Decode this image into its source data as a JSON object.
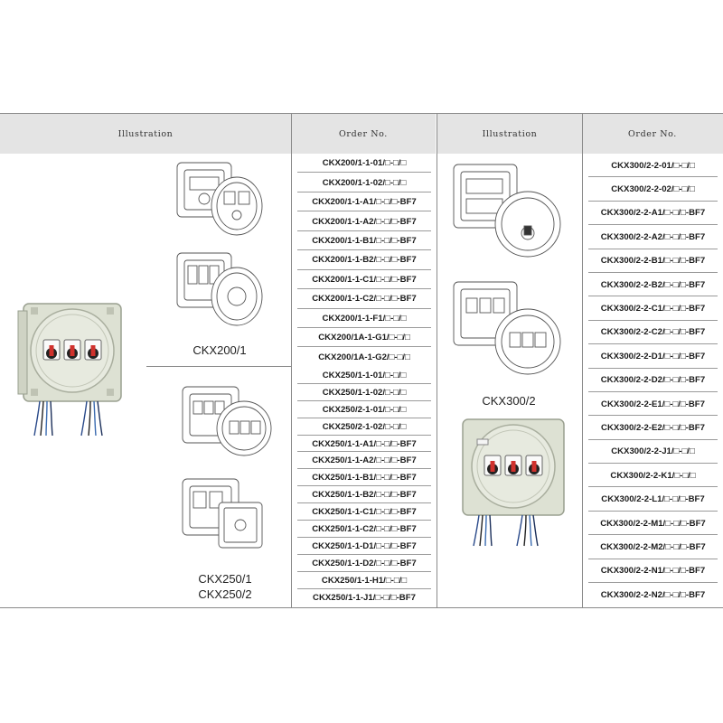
{
  "table": {
    "left_group": {
      "illustration_header": "Illustration",
      "order_header": "Order No.",
      "ckx200_label": "CKX200/1",
      "ckx250_label_line1": "CKX250/1",
      "ckx250_label_line2": "CKX250/2",
      "ckx200_orders": [
        "CKX200/1-1-01/□-□/□",
        "CKX200/1-1-02/□-□/□",
        "CKX200/1-1-A1/□-□/□-BF7",
        "CKX200/1-1-A2/□-□/□-BF7",
        "CKX200/1-1-B1/□-□/□-BF7",
        "CKX200/1-1-B2/□-□/□-BF7",
        "CKX200/1-1-C1/□-□/□-BF7",
        "CKX200/1-1-C2/□-□/□-BF7",
        "CKX200/1-1-F1/□-□/□",
        "CKX200/1A-1-G1/□-□/□",
        "CKX200/1A-1-G2/□-□/□"
      ],
      "ckx250_orders": [
        "CKX250/1-1-01/□-□/□",
        "CKX250/1-1-02/□-□/□",
        "CKX250/2-1-01/□-□/□",
        "CKX250/2-1-02/□-□/□",
        "CKX250/1-1-A1/□-□/□-BF7",
        "CKX250/1-1-A2/□-□/□-BF7",
        "CKX250/1-1-B1/□-□/□-BF7",
        "CKX250/1-1-B2/□-□/□-BF7",
        "CKX250/1-1-C1/□-□/□-BF7",
        "CKX250/1-1-C2/□-□/□-BF7",
        "CKX250/1-1-D1/□-□/□-BF7",
        "CKX250/1-1-D2/□-□/□-BF7",
        "CKX250/1-1-H1/□-□/□",
        "CKX250/1-1-J1/□-□/□-BF7"
      ]
    },
    "right_group": {
      "illustration_header": "Illustration",
      "order_header": "Order No.",
      "ckx300_label": "CKX300/2",
      "ckx300_orders": [
        "CKX300/2-2-01/□-□/□",
        "CKX300/2-2-02/□-□/□",
        "CKX300/2-2-A1/□-□/□-BF7",
        "CKX300/2-2-A2/□-□/□-BF7",
        "CKX300/2-2-B1/□-□/□-BF7",
        "CKX300/2-2-B2/□-□/□-BF7",
        "CKX300/2-2-C1/□-□/□-BF7",
        "CKX300/2-2-C2/□-□/□-BF7",
        "CKX300/2-2-D1/□-□/□-BF7",
        "CKX300/2-2-D2/□-□/□-BF7",
        "CKX300/2-2-E1/□-□/□-BF7",
        "CKX300/2-2-E2/□-□/□-BF7",
        "CKX300/2-2-J1/□-□/□",
        "CKX300/2-2-K1/□-□/□",
        "CKX300/2-2-L1/□-□/□-BF7",
        "CKX300/2-2-M1/□-□/□-BF7",
        "CKX300/2-2-M2/□-□/□-BF7",
        "CKX300/2-2-N1/□-□/□-BF7",
        "CKX300/2-2-N2/□-□/□-BF7"
      ]
    }
  },
  "colors": {
    "header_bg": "#e4e4e4",
    "rule": "#8a8a8a",
    "enclosure": "#dde1d3",
    "switch_red": "#d0312d"
  },
  "icons": [
    "ckx200-drawing-icon",
    "ckx250-drawing-icon",
    "ckx300-drawing-icon",
    "enclosure-photo-icon"
  ]
}
